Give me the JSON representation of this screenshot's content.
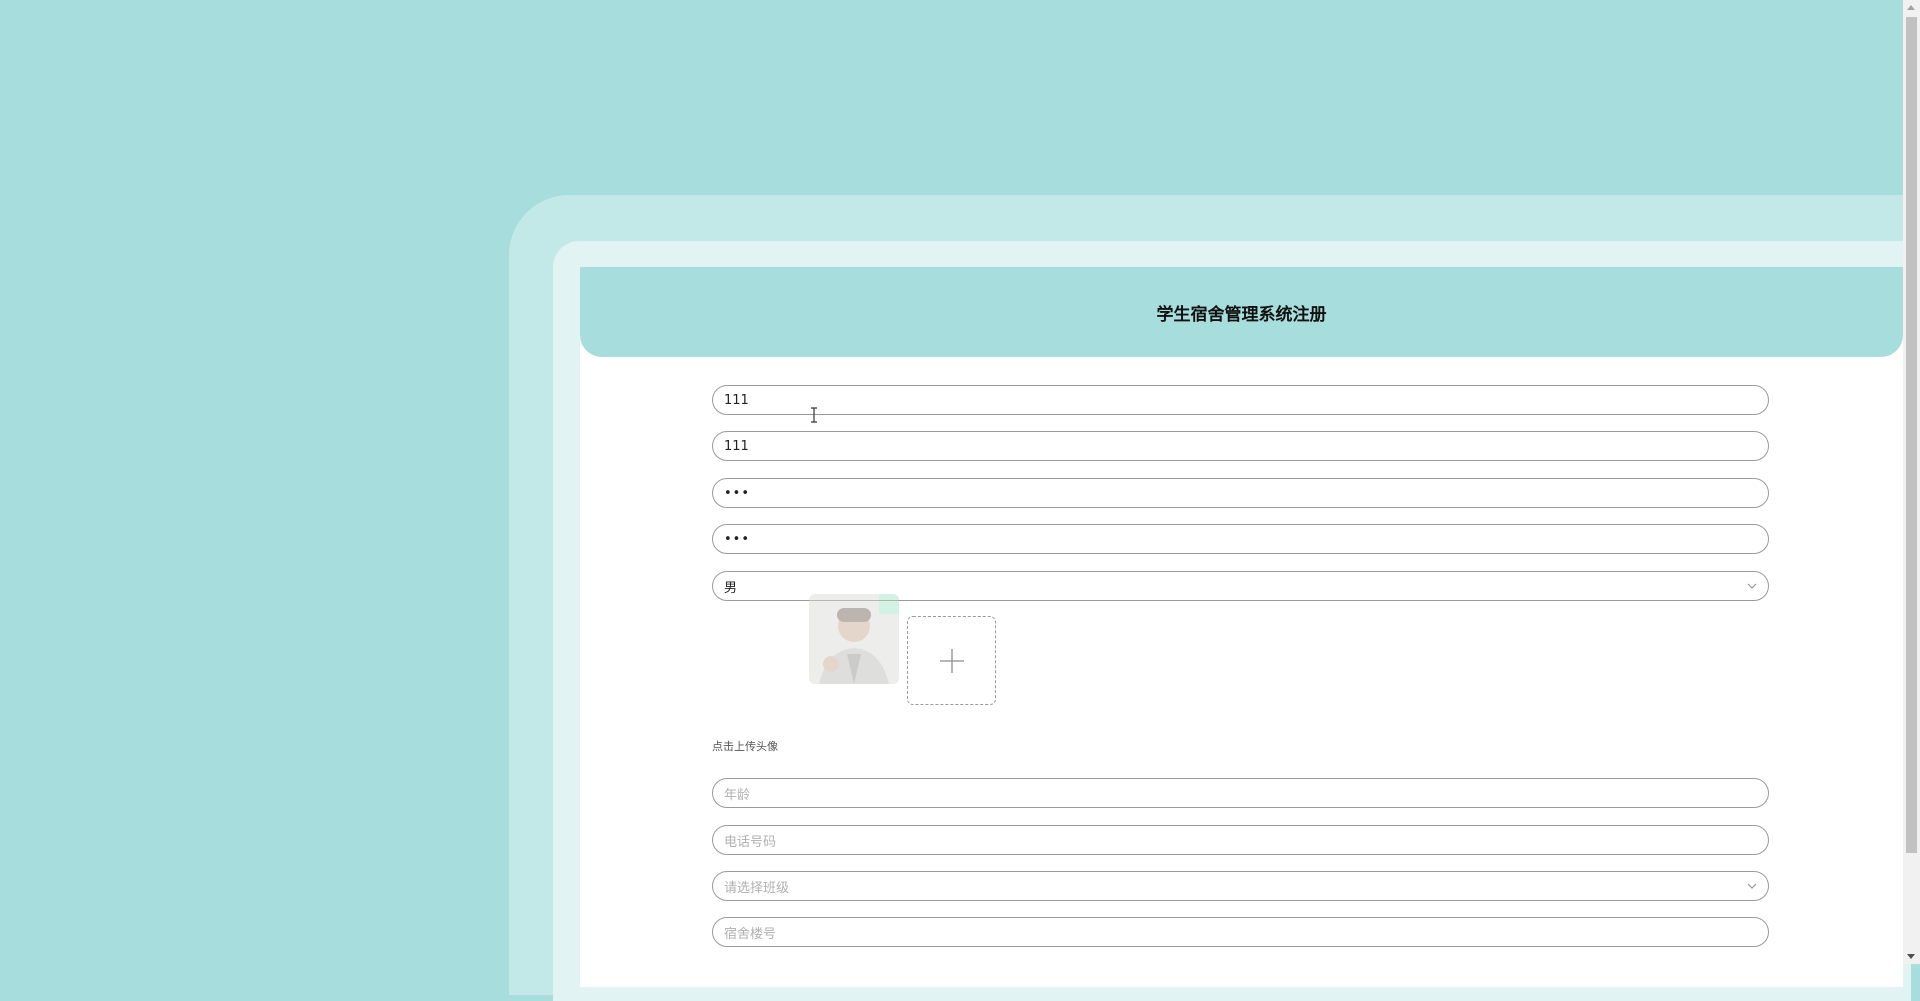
{
  "form": {
    "title": "学生宿舍管理系统注册",
    "username_value": "111",
    "name_value": "111",
    "password_value": "•••",
    "confirm_password_value": "•••",
    "gender_value": "男",
    "upload_hint": "点击上传头像",
    "age_placeholder": "年龄",
    "phone_placeholder": "电话号码",
    "class_placeholder": "请选择班级",
    "dorm_placeholder": "宿舍楼号"
  },
  "icons": {
    "upload": "plus-icon",
    "select": "chevron-down-icon",
    "cursor": "text-cursor-icon"
  },
  "colors": {
    "background": "#a7dddc",
    "frame_outer": "#c3e8e8",
    "frame_inner": "#e2f3f3",
    "header": "#a7dddc",
    "field_border": "#9a9a9a"
  }
}
